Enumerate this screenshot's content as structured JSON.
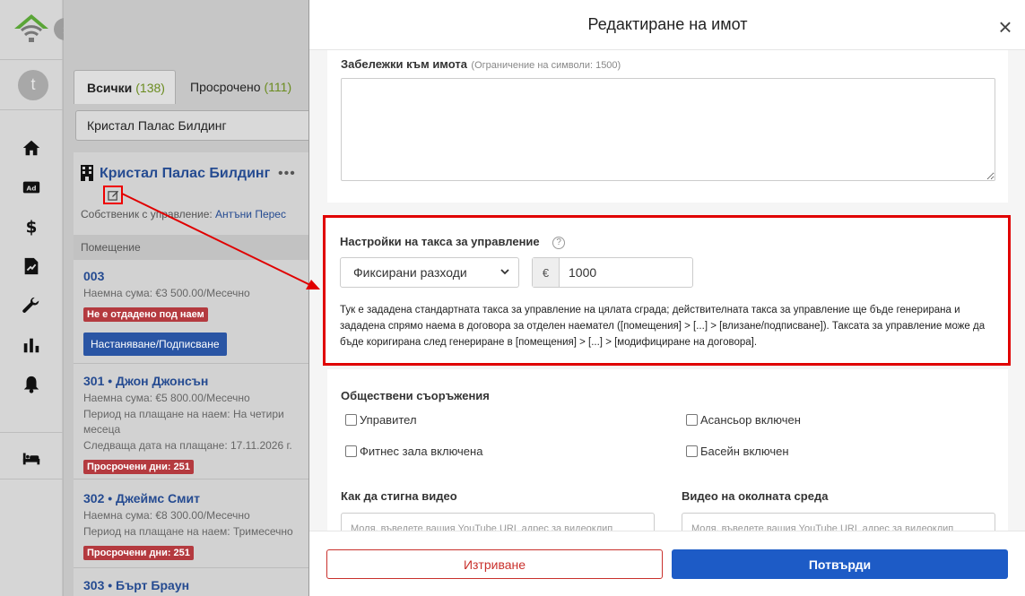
{
  "brand": {
    "accent": "#1d5bc6",
    "danger": "#c9302c",
    "highlight": "#e00000",
    "logo_color": "#5aa537"
  },
  "rail": {
    "avatar_letter": "t",
    "nav_icons": [
      "home-icon",
      "ad-icon",
      "dollar-icon",
      "contract-icon",
      "wrench-icon",
      "bar-chart-icon",
      "bell-icon",
      "bed-icon"
    ],
    "ad_label": "Ad"
  },
  "list": {
    "tabs": [
      {
        "label": "Всички",
        "count": "(138)"
      },
      {
        "label": "Просрочено",
        "count": "(111)"
      }
    ],
    "search_value": "Кристал Палас Билдинг",
    "building": {
      "name": "Кристал Палас Билдинг",
      "more": "•••",
      "owner_label": "Собственик с управление: ",
      "owner_name": "Антъни Перес"
    },
    "column_header": "Помещение",
    "units": [
      {
        "num": "003",
        "rent": "Наемна сума: €3 500.00/Месечно",
        "badge": "Не е отдадено под наем",
        "button": "Настаняване/Подписване"
      },
      {
        "num": "301 • Джон Джонсън",
        "rent": "Наемна сума: €5 800.00/Месечно",
        "period": "Период на плащане на наем: На четири",
        "period2": "месеца",
        "next": "Следваща дата на плащане:  17.11.2026 г.",
        "badge": "Просрочени дни: 251"
      },
      {
        "num": "302 • Джеймс Смит",
        "rent": "Наемна сума: €8 300.00/Месечно",
        "period": "Период на плащане на наем: Тримесечно",
        "badge": "Просрочени дни: 251"
      },
      {
        "num": "303 • Бърт Браун"
      }
    ]
  },
  "modal": {
    "title": "Редактиране на имот",
    "notes": {
      "label": "Забележки към имота",
      "hint": "(Ограничение на символи: 1500)",
      "value": ""
    },
    "fee": {
      "label": "Настройки на такса за управление",
      "help": "?",
      "type": "Фиксирани разходи",
      "currency": "€",
      "amount": "1000",
      "description": "Тук е зададена стандартната такса за управление на цялата сграда; действителната такса за управление ще бъде генерирана и зададена спрямо наема в договора за отделен наемател ([помещения] > [...] > [влизане/подписване]). Таксата за управление може да бъде коригирана след генериране в [помещения] > [...] > [модифициране на договора]."
    },
    "facilities": {
      "label": "Обществени съоръжения",
      "items": [
        "Управител",
        "Асансьор включен",
        "Фитнес зала включена",
        "Басейн включен"
      ]
    },
    "video_how": {
      "label": "Как да стигна видео",
      "placeholder": "Моля, въведете вашия YouTube URL адрес за видеоклип"
    },
    "video_env": {
      "label": "Видео на околната среда",
      "placeholder": "Моля, въведете вашия YouTube URL адрес за видеоклип"
    },
    "delete_label": "Изтриване",
    "confirm_label": "Потвърди"
  }
}
